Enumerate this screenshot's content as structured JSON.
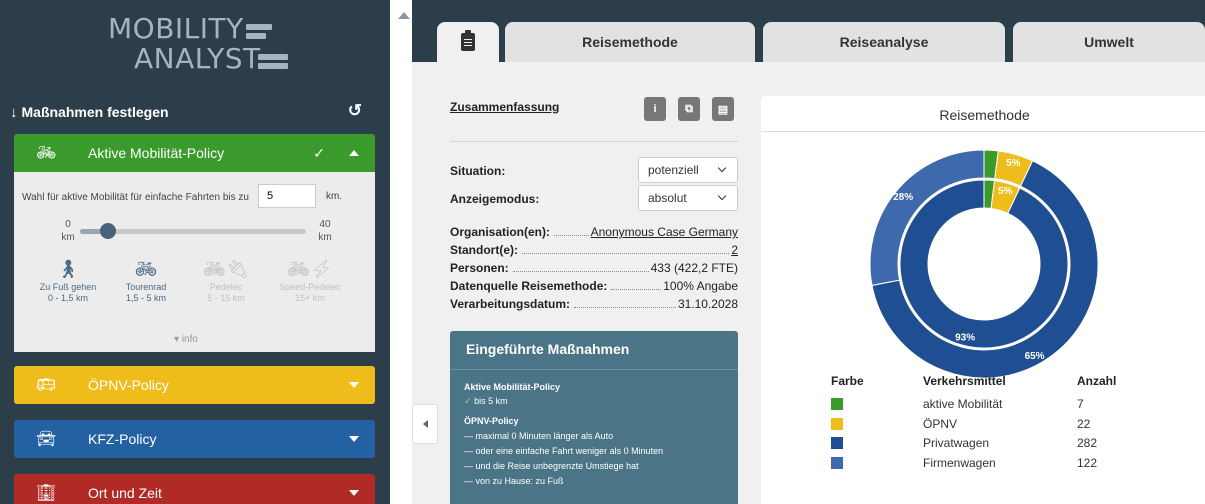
{
  "sidebar": {
    "logo_line1": "MOBILITY",
    "logo_line2": "ANALYST",
    "measures_header": "Maßnahmen festlegen",
    "active_policy": {
      "title": "Aktive Mobilität-Policy",
      "wahl_label": "Wahl für aktive Mobilität für einfache Fahrten bis zu",
      "km_value": "5",
      "km_unit": "km.",
      "range_min": "0",
      "range_min_unit": "km",
      "range_max": "40",
      "range_max_unit": "km",
      "slider_value_km": 5,
      "modes": [
        {
          "label": "Zu Fuß gehen",
          "range": "0 - 1,5 km",
          "icon": "walking-icon",
          "active": true
        },
        {
          "label": "Tourenrad",
          "range": "1,5 - 5 km",
          "icon": "bicycle-icon",
          "active": true
        },
        {
          "label": "Pedelec",
          "range": "5 - 15 km",
          "icon": "pedelec-icon",
          "active": false
        },
        {
          "label": "Speed-Pedelec",
          "range": "15+ km",
          "icon": "speed-pedelec-icon",
          "active": false
        }
      ],
      "info": "info"
    },
    "oepnv_policy": {
      "title": "ÖPNV-Policy"
    },
    "kfz_policy": {
      "title": "KFZ-Policy"
    },
    "ort_policy": {
      "title": "Ort und Zeit"
    }
  },
  "tabs": {
    "summary_icon": "clipboard-icon",
    "reisemethode": "Reisemethode",
    "reiseanalyse": "Reiseanalyse",
    "umwelt": "Umwelt"
  },
  "summary": {
    "title": "Zusammenfassung",
    "situation_label": "Situation:",
    "situation_value": "potenziell",
    "anzeigemodus_label": "Anzeigemodus:",
    "anzeigemodus_value": "absolut",
    "rows": [
      {
        "label": "Organisation(en):",
        "value": "Anonymous Case Germany"
      },
      {
        "label": "Standort(e):",
        "value": "2"
      },
      {
        "label": "Personen:",
        "value": "433 (422,2 FTE)"
      },
      {
        "label": "Datenquelle Reisemethode:",
        "value": "100% Angabe"
      },
      {
        "label": "Verarbeitungsdatum:",
        "value": "31.10.2028"
      }
    ]
  },
  "measures_box": {
    "title": "Eingeführte Maßnahmen",
    "lines": [
      "Aktive Mobilität-Policy",
      "bis 5 km",
      "ÖPNV-Policy",
      "— maximal 0 Minuten länger als Auto",
      "— oder eine einfache Fahrt weniger als 0 Minuten",
      "— und die Reise unbegrenzte Umstiege hat",
      "— von zu Hause: zu Fuß"
    ]
  },
  "chart_card": {
    "title": "Reisemethode",
    "legend_headers": [
      "Farbe",
      "Verkehrsmittel",
      "Anzahl"
    ]
  },
  "chart_data": {
    "type": "pie",
    "title": "Reisemethode",
    "rings": [
      "inner",
      "outer"
    ],
    "series": [
      {
        "name": "aktive Mobilität",
        "color": "#3a9a2b",
        "count": 7,
        "inner_pct": 2,
        "outer_pct": 2
      },
      {
        "name": "ÖPNV",
        "color": "#efbd1b",
        "count": 22,
        "inner_pct": 5,
        "outer_pct": 5
      },
      {
        "name": "Privatwagen",
        "color": "#1f4f92",
        "count": 282,
        "inner_pct": 93,
        "outer_pct": 65
      },
      {
        "name": "Firmenwagen",
        "color": "#3f69ad",
        "count": 122,
        "inner_pct": 0,
        "outer_pct": 28
      }
    ],
    "data_labels": [
      "5%",
      "5%",
      "28%",
      "93%",
      "65%"
    ]
  },
  "colors": {
    "sidebar_bg": "#2d3e4b",
    "active_green": "#3a9a2b",
    "oepnv_yellow": "#efbd1b",
    "kfz_blue": "#2461a3",
    "ort_red": "#b12b26",
    "measures_teal": "#4c7487"
  }
}
